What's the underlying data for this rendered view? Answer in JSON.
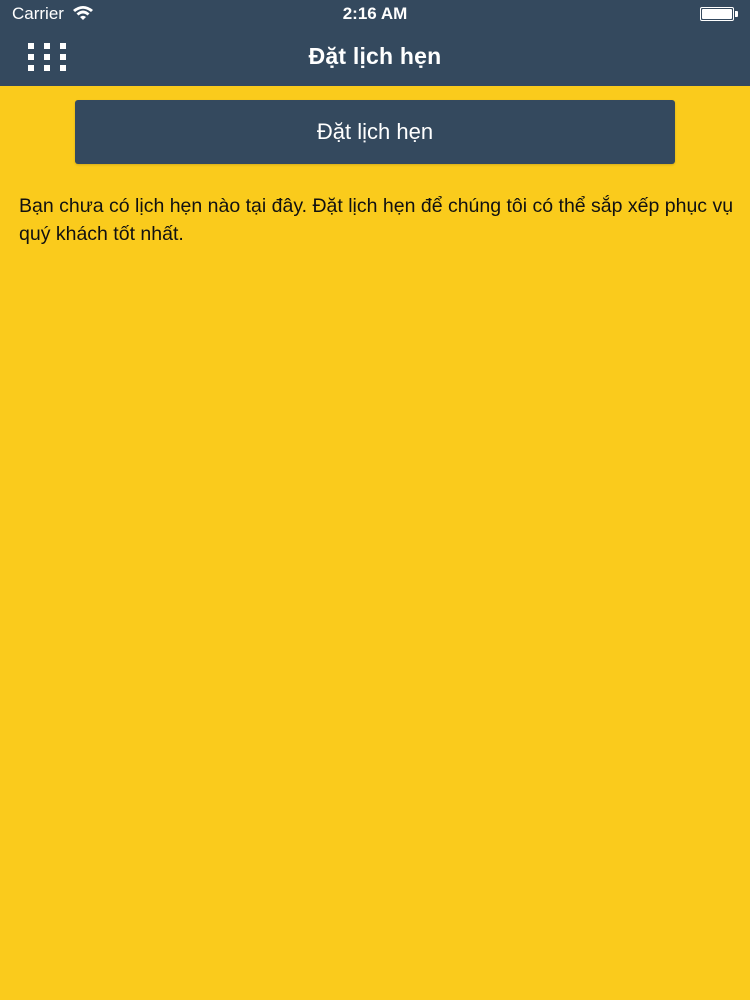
{
  "status_bar": {
    "carrier": "Carrier",
    "time": "2:16 AM",
    "battery_level": 1.0
  },
  "nav": {
    "title": "Đặt lịch hẹn",
    "menu_icon": "grid-menu-icon"
  },
  "main": {
    "book_button_label": "Đặt lịch hẹn",
    "empty_message": "Bạn chưa có lịch hẹn nào tại đây. Đặt lịch hẹn để chúng tôi có thể sắp xếp phục vụ quý khách tốt nhất."
  },
  "colors": {
    "background": "#FACB1C",
    "primary": "#34495E",
    "text_on_primary": "#FFFFFF",
    "body_text": "#111111"
  }
}
